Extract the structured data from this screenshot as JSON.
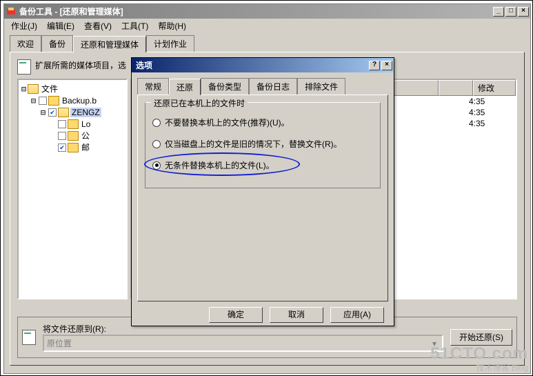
{
  "app": {
    "title": "备份工具 - [还原和管理媒体]",
    "menus": {
      "job": "作业(J)",
      "edit": "编辑(E)",
      "view": "查看(V)",
      "tools": "工具(T)",
      "help": "帮助(H)"
    },
    "tabs": {
      "welcome": "欢迎",
      "backup": "备份",
      "restore": "还原和管理媒体",
      "schedule": "计划作业"
    },
    "instruction": "扩展所需的媒体项目，选",
    "tree": {
      "root": "文件",
      "items": [
        {
          "label": "Backup.b",
          "checked": false
        },
        {
          "label": "ZENGZ",
          "checked": true
        },
        {
          "label": "Lo",
          "checked": false
        },
        {
          "label": "公",
          "checked": false
        },
        {
          "label": "邮",
          "checked": true
        }
      ]
    },
    "list": {
      "columns": {
        "name": "",
        "size": "",
        "modified": "修改"
      },
      "rows": [
        {
          "modified": "4:35"
        },
        {
          "modified": "4:35"
        },
        {
          "modified": "4:35"
        }
      ]
    },
    "restore_to": {
      "label": "将文件还原到(R):",
      "value": "原位置"
    },
    "start_button": "开始还原(S)"
  },
  "dialog": {
    "title": "选项",
    "tabs": {
      "general": "常规",
      "restore": "还原",
      "backup_type": "备份类型",
      "backup_log": "备份日志",
      "exclude": "排除文件"
    },
    "group_title": "还原已在本机上的文件时",
    "radios": {
      "no_replace": "不要替换本机上的文件(推荐)(U)。",
      "replace_if_older": "仅当磁盘上的文件是旧的情况下，替换文件(R)。",
      "always_replace": "无条件替换本机上的文件(L)。"
    },
    "buttons": {
      "ok": "确定",
      "cancel": "取消",
      "apply": "应用(A)"
    }
  },
  "watermark": {
    "big": "51CTO.com",
    "small": "技术博客  Blog"
  }
}
